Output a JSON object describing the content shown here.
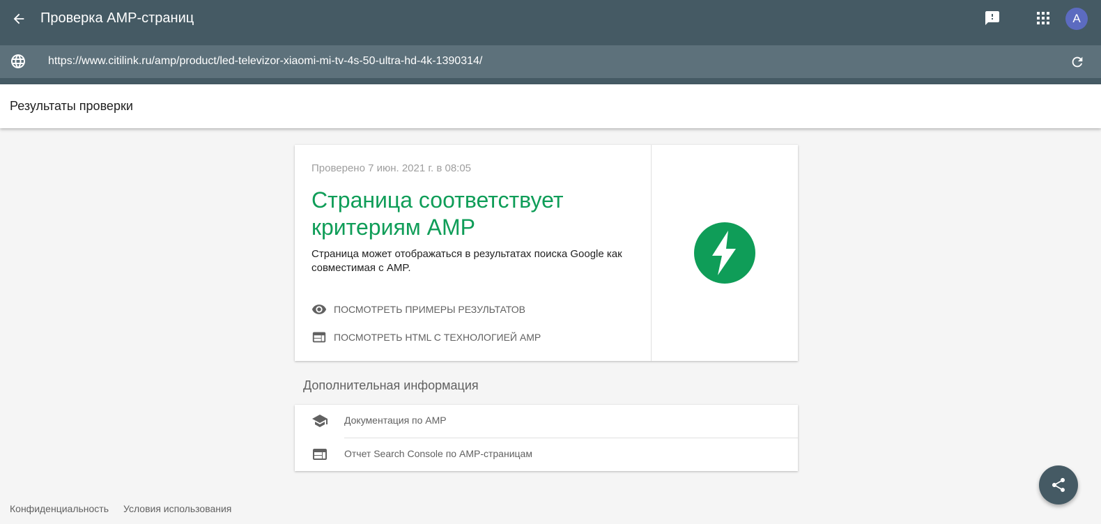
{
  "app": {
    "title": "Проверка AMP-страниц",
    "avatar_letter": "A"
  },
  "urlbar": {
    "url": "https://www.citilink.ru/amp/product/led-televizor-xiaomi-mi-tv-4s-50-ultra-hd-4k-1390314/"
  },
  "subheader": {
    "title": "Результаты проверки"
  },
  "result": {
    "checked_date": "Проверено 7 июн. 2021 г. в 08:05",
    "heading": "Страница соответствует критериям AMP",
    "description": "Страница может отображаться в результатах поиска Google как совместимая с AMP.",
    "actions": [
      {
        "label": "ПОСМОТРЕТЬ ПРИМЕРЫ РЕЗУЛЬТАТОВ",
        "icon": "eye-icon"
      },
      {
        "label": "ПОСМОТРЕТЬ HTML С ТЕХНОЛОГИЕЙ AMP",
        "icon": "web-icon"
      }
    ]
  },
  "more_info": {
    "title": "Дополнительная информация",
    "links": [
      {
        "label": "Документация по AMP",
        "icon": "school-icon"
      },
      {
        "label": "Отчет Search Console по AMP-страницам",
        "icon": "web-icon"
      }
    ]
  },
  "footer": {
    "privacy": "Конфиденциальность",
    "terms": "Условия использования"
  },
  "colors": {
    "appbar": "#455a64",
    "urlbar": "#5d717b",
    "success": "#0f9d58",
    "avatar": "#5c6bc0"
  }
}
